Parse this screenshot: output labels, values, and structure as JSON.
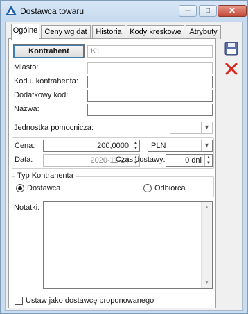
{
  "window": {
    "title": "Dostawca towaru",
    "minimize": "─",
    "maximize": "□",
    "close": "✕"
  },
  "tabs": [
    {
      "label": "Ogólne",
      "active": true
    },
    {
      "label": "Ceny wg dat"
    },
    {
      "label": "Historia"
    },
    {
      "label": "Kody kreskowe"
    },
    {
      "label": "Atrybuty"
    }
  ],
  "form": {
    "kontrahent_button": "Kontrahent",
    "kontrahent_value": "K1",
    "miasto_label": "Miasto:",
    "miasto_value": "",
    "kod_label": "Kod u kontrahenta:",
    "kod_value": "",
    "dodatkowy_label": "Dodatkowy kod:",
    "dodatkowy_value": "",
    "nazwa_label": "Nazwa:",
    "nazwa_value": "",
    "jednostka_label": "Jednostka pomocnicza:",
    "jednostka_value": "",
    "cena_label": "Cena:",
    "cena_value": "200,0000",
    "waluta_value": "PLN",
    "data_label": "Data:",
    "data_value": "2020-11-24",
    "czas_label": "Czas dostawy:",
    "czas_value": "0 dni",
    "typ_title": "Typ Kontrahenta",
    "dostawca_label": "Dostawca",
    "odbiorca_label": "Odbiorca",
    "notatki_label": "Notatki:",
    "notatki_value": "",
    "proponowany_label": "Ustaw jako dostawcę proponowanego"
  },
  "colors": {
    "save_icon": "#5a6fa8",
    "delete_icon": "#d9261c"
  }
}
